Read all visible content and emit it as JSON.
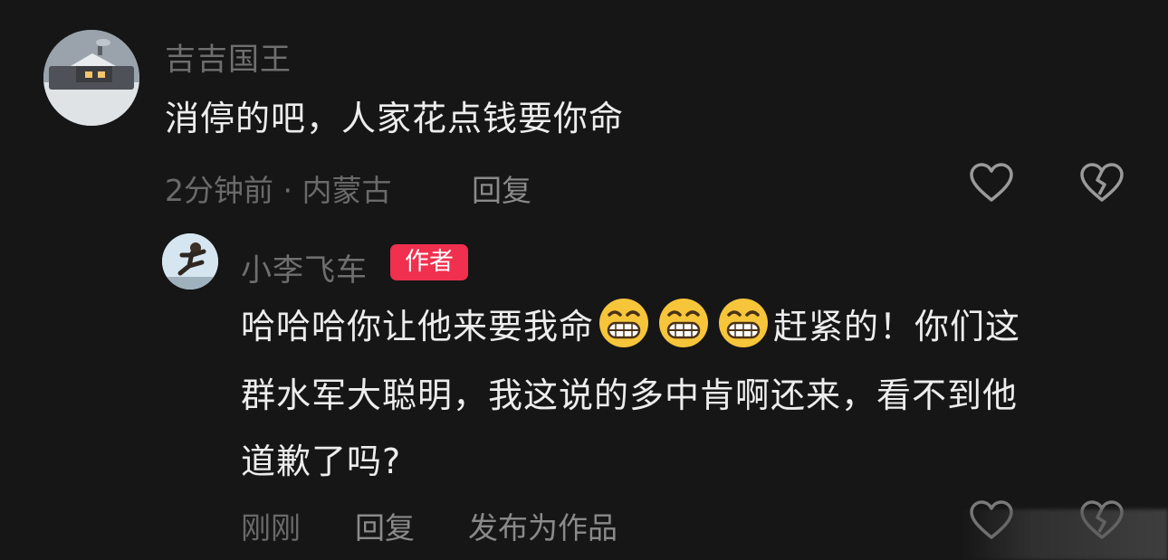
{
  "comment": {
    "username": "吉吉国王",
    "text": "消停的吧，人家花点钱要你命",
    "meta": "2分钟前 · 内蒙古",
    "reply_label": "回复",
    "like_icon": "heart-outline-icon",
    "dislike_icon": "broken-heart-icon"
  },
  "reply": {
    "username": "小李飞车",
    "badge": "作者",
    "text_part1": "哈哈哈你让他来要我命",
    "emoji": "grinning-face-emoji",
    "text_part2": "赶紧的！你们这",
    "line2": "群水军大聪明，我这说的多中肯啊还来，看不到他",
    "line3": "道歉了吗?",
    "time": "刚刚",
    "reply_label": "回复",
    "publish_label": "发布为作品",
    "like_icon": "heart-outline-icon",
    "dislike_icon": "broken-heart-icon"
  },
  "colors": {
    "background": "#161616",
    "author_badge": "#f0304e",
    "username": "#6f6f6f",
    "text": "#ededed"
  }
}
